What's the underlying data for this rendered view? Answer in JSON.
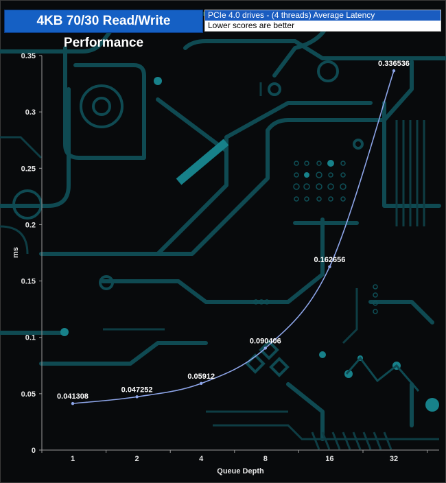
{
  "colors": {
    "background": "#080a0c",
    "circuit": "#0f4a52",
    "circuit_bright": "#17818a",
    "title_bg": "#1560c4",
    "series_line": "#8ea6ea",
    "axis": "#9a9a9a"
  },
  "title": "4KB 70/30 Read/Write Performance",
  "legend": {
    "series_name": "PCIe 4.0 drives - (4 threads) Average Latency",
    "note": "Lower scores are better"
  },
  "chart_data": {
    "type": "line",
    "title": "4KB 70/30 Read/Write Performance",
    "xlabel": "Queue Depth",
    "ylabel": "ms",
    "categories": [
      "1",
      "2",
      "4",
      "8",
      "16",
      "32"
    ],
    "series": [
      {
        "name": "PCIe 4.0 drives - (4 threads) Average Latency",
        "values": [
          0.041308,
          0.047252,
          0.05912,
          0.090406,
          0.162656,
          0.336536
        ],
        "labels": [
          "0.041308",
          "0.047252",
          "0.05912",
          "0.090406",
          "0.162656",
          "0.336536"
        ]
      }
    ],
    "ylim": [
      0,
      0.35
    ],
    "yticks": [
      0,
      0.05,
      0.1,
      0.15,
      0.2,
      0.25,
      0.3,
      0.35
    ],
    "ytick_labels": [
      "0",
      "0.05",
      "0.1",
      "0.15",
      "0.2",
      "0.25",
      "0.3",
      "0.35"
    ],
    "grid": false,
    "legend_position": "top-right"
  }
}
